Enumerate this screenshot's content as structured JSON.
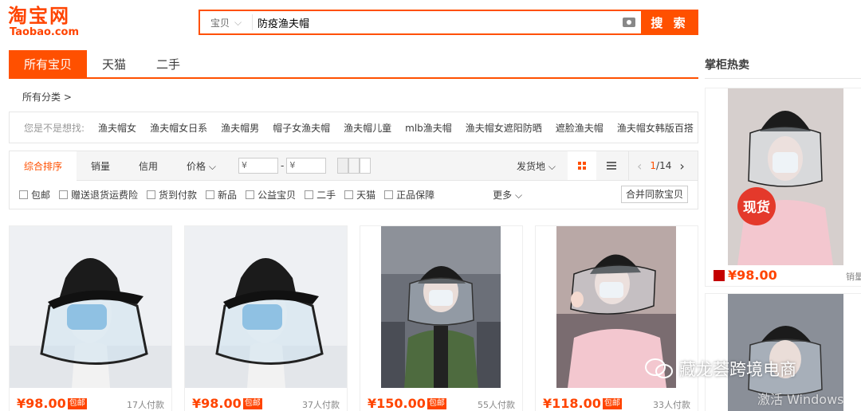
{
  "logo": {
    "cn": "淘宝网",
    "en": "Taobao.com"
  },
  "search": {
    "type_label": "宝贝",
    "query": "防疫渔夫帽",
    "button_label": "搜 索"
  },
  "tabs": [
    {
      "label": "所有宝贝",
      "active": true
    },
    {
      "label": "天猫",
      "active": false
    },
    {
      "label": "二手",
      "active": false
    }
  ],
  "category": {
    "label": "所有分类 >"
  },
  "related": {
    "label": "您是不是想找:",
    "items": [
      "渔夫帽女",
      "渔夫帽女日系",
      "渔夫帽男",
      "帽子女渔夫帽",
      "渔夫帽儿童",
      "mlb渔夫帽",
      "渔夫帽女遮阳防晒",
      "遮脸渔夫帽",
      "渔夫帽女韩版百搭"
    ]
  },
  "sortbar": {
    "sorts": [
      "综合排序",
      "销量",
      "信用",
      "价格 ⌵"
    ],
    "price_min": "¥",
    "price_max": "¥",
    "price_dash": "-",
    "location": "发货地 ⌵",
    "pager_current": "1",
    "pager_total": "/14",
    "pager_prev": "‹",
    "pager_next": "›"
  },
  "filters": {
    "options": [
      "包邮",
      "赠送退货运费险",
      "货到付款",
      "新品",
      "公益宝贝",
      "二手",
      "天猫",
      "正品保障"
    ],
    "more": "更多 ⌵",
    "merge": "合并同款宝贝"
  },
  "products": [
    {
      "price": "¥98.00",
      "badge": "包邮",
      "deals": "17人付款",
      "image": "mannequin-bucket-hat-face-shield"
    },
    {
      "price": "¥98.00",
      "badge": "包邮",
      "deals": "37人付款",
      "image": "mannequin-bucket-hat-face-shield"
    },
    {
      "price": "¥150.00",
      "badge": "包邮",
      "deals": "55人付款",
      "image": "woman-green-jacket-hat-shield"
    },
    {
      "price": "¥118.00",
      "badge": "包邮",
      "deals": "33人付款",
      "image": "woman-pink-shirt-hat-shield"
    }
  ],
  "sidebar": {
    "title": "掌柜热卖",
    "hot_label": "现货",
    "price": "¥98.00",
    "sales": "销量"
  },
  "watermark": {
    "text": "藏龙荟跨境电商",
    "activate": "激活 Windows"
  },
  "colors": {
    "accent": "#ff5000",
    "price": "#ff4400"
  }
}
